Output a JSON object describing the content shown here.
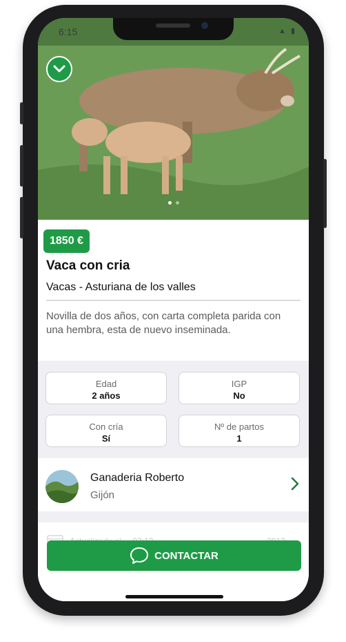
{
  "status_bar": {
    "time": "6:15",
    "icons": "▲ ▮"
  },
  "listing": {
    "price": "1850 €",
    "title": "Vaca con cria",
    "category": "Vacas - Asturiana de los valles",
    "description": "Novilla de dos años, con carta completa parida con una hembra, esta de nuevo inseminada."
  },
  "attributes": [
    {
      "label": "Edad",
      "value": "2 años"
    },
    {
      "label": "IGP",
      "value": "No"
    },
    {
      "label": "Con cría",
      "value": "Sí"
    },
    {
      "label": "Nº de partos",
      "value": "1"
    }
  ],
  "seller": {
    "name": "Ganaderia Roberto",
    "city": "Gijón"
  },
  "meta": {
    "left_text": "Actualizado el ... 03:12",
    "right_text": "2813"
  },
  "contact": {
    "label": "CONTACTAR"
  },
  "colors": {
    "accent": "#1f9b48",
    "background": "#efeff4"
  },
  "icons": {
    "collapse": "chevron-down-icon",
    "seller_arrow": "chevron-right-icon",
    "contact": "chat-bubble-icon"
  }
}
